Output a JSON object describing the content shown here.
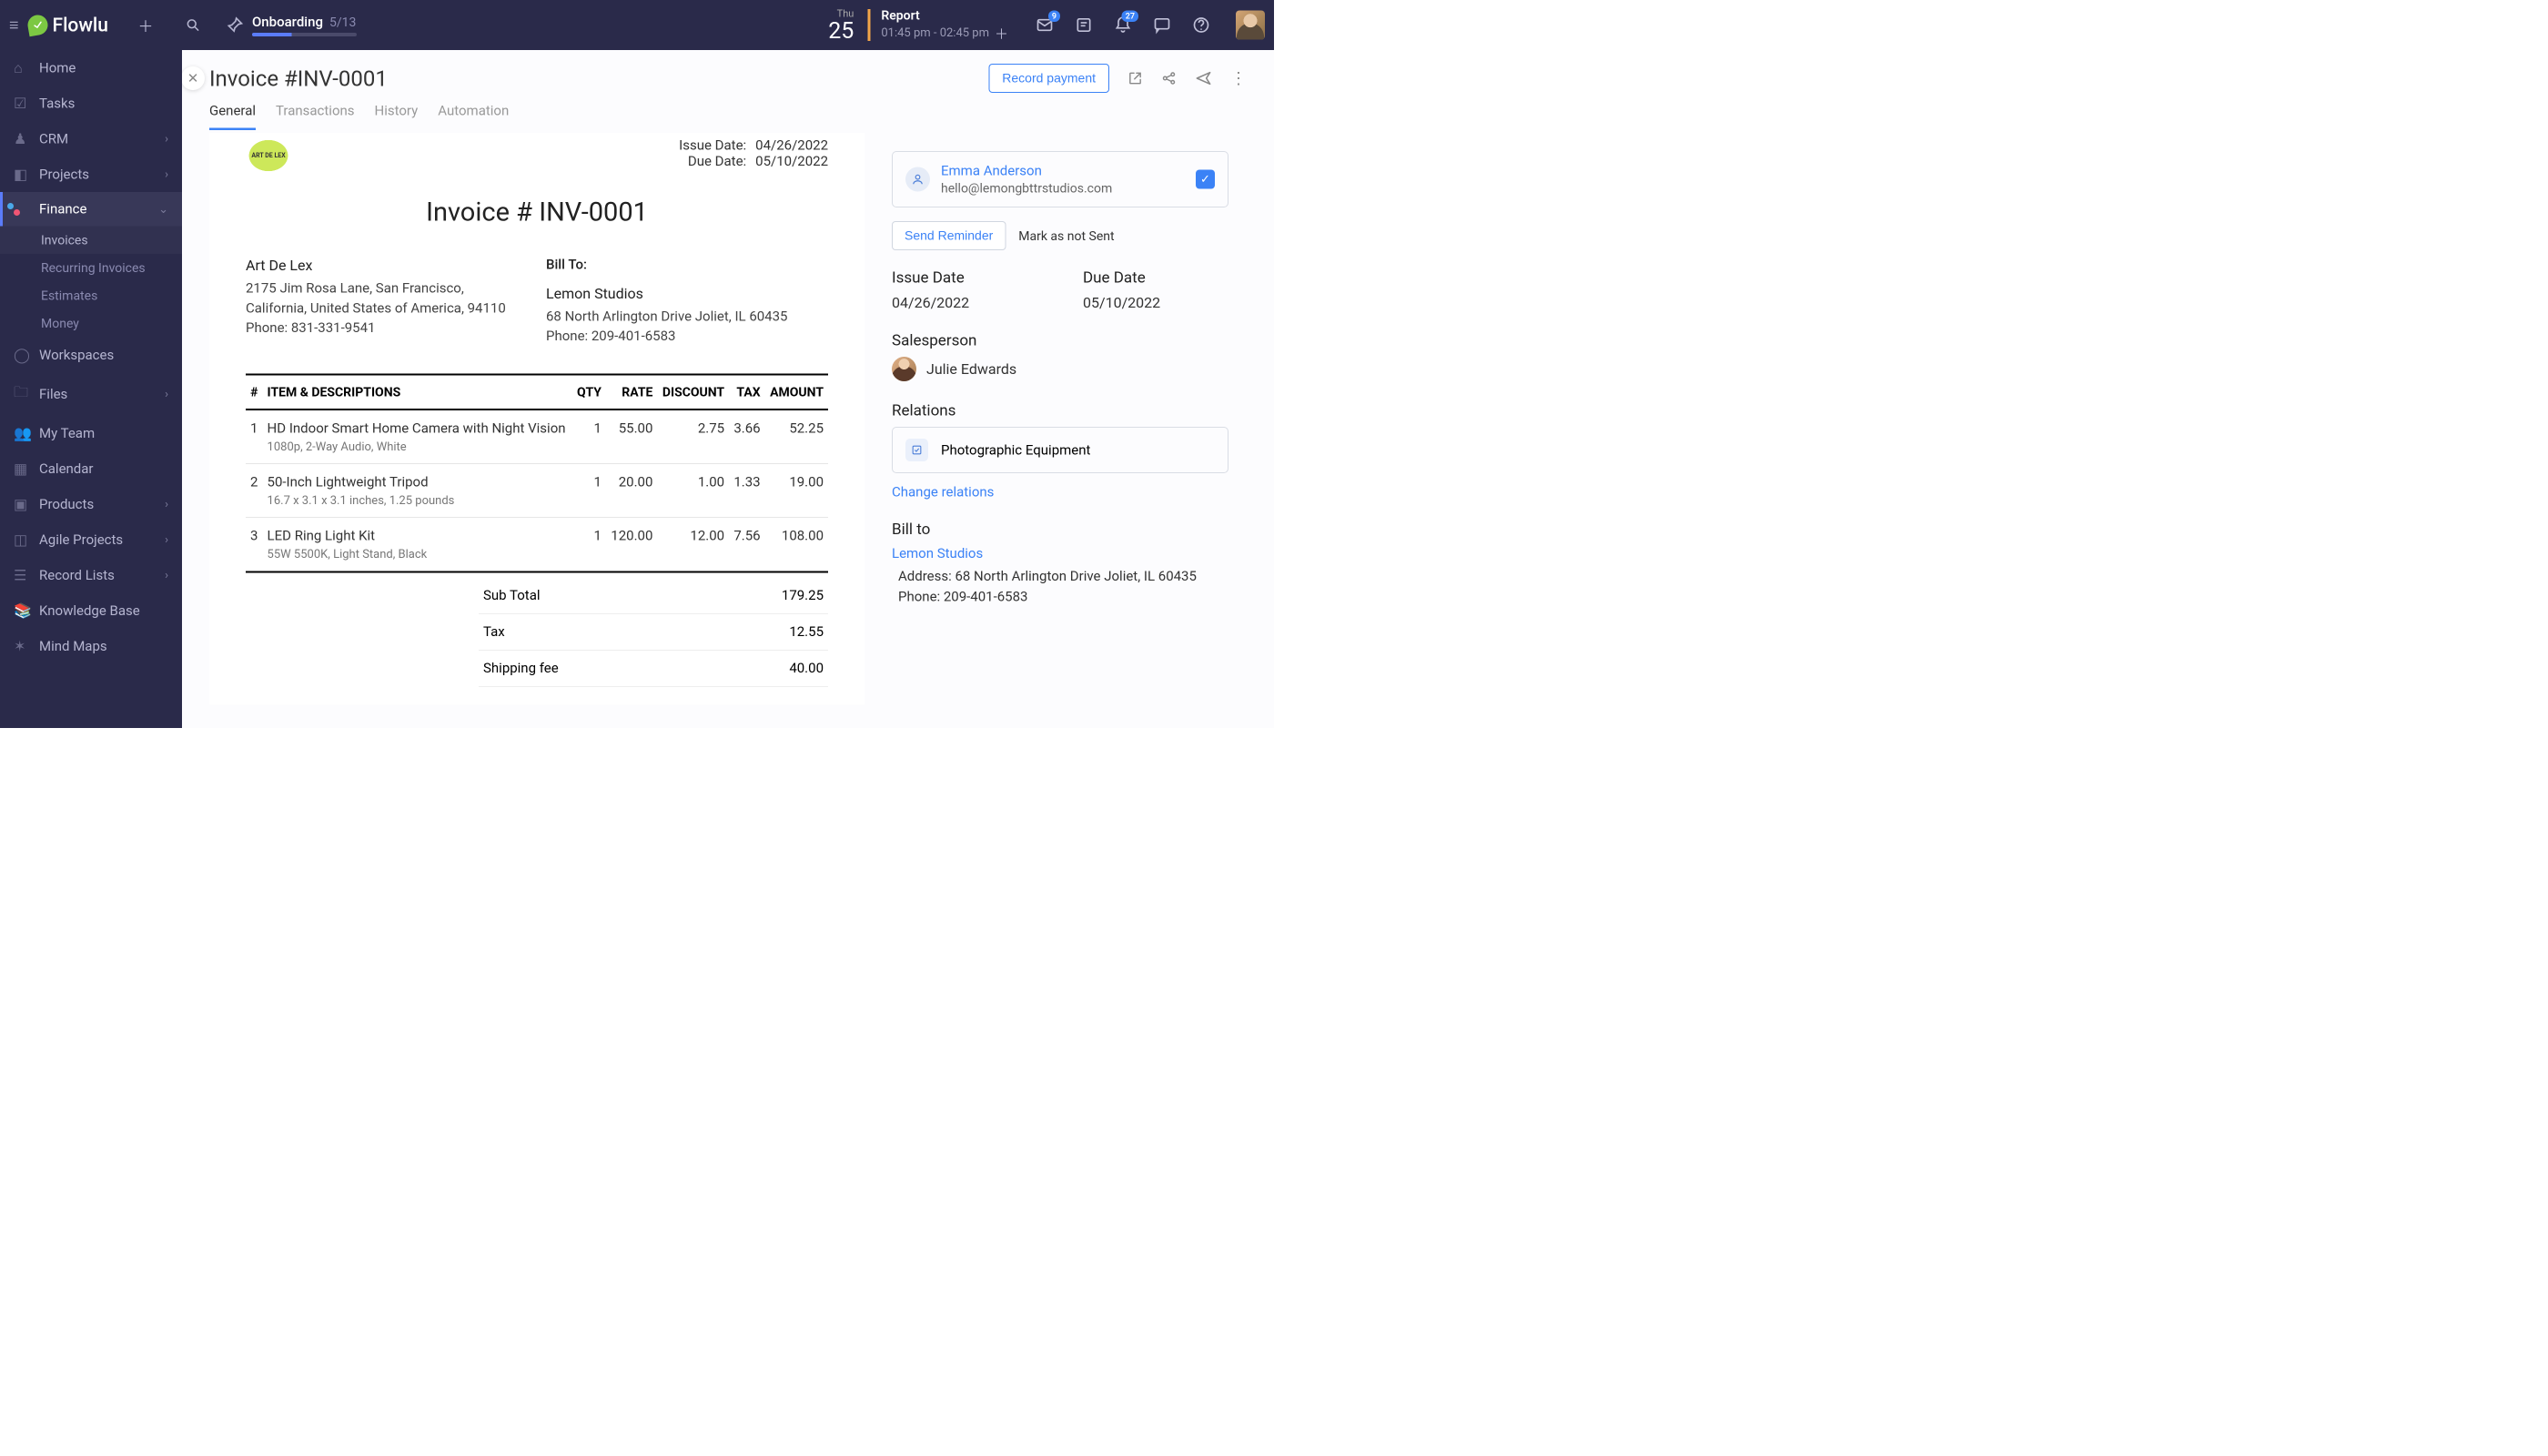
{
  "brand": "Flowlu",
  "topbar": {
    "onboarding_label": "Onboarding",
    "onboarding_count": "5/13",
    "day_name": "Thu",
    "day_num": "25",
    "report_label": "Report",
    "report_time": "01:45 pm - 02:45 pm",
    "mail_badge": "9",
    "bell_badge": "27"
  },
  "sidebar": {
    "home": "Home",
    "tasks": "Tasks",
    "crm": "CRM",
    "projects": "Projects",
    "finance": "Finance",
    "invoices": "Invoices",
    "recurring": "Recurring Invoices",
    "estimates": "Estimates",
    "money": "Money",
    "workspaces": "Workspaces",
    "files": "Files",
    "myteam": "My Team",
    "calendar": "Calendar",
    "products": "Products",
    "agile": "Agile Projects",
    "recordlists": "Record Lists",
    "knowledge": "Knowledge Base",
    "mindmaps": "Mind Maps"
  },
  "header": {
    "title": "Invoice #INV-0001",
    "record_payment": "Record payment"
  },
  "tabs": {
    "general": "General",
    "transactions": "Transactions",
    "history": "History",
    "automation": "Automation"
  },
  "doc": {
    "logo_text": "ART DE LEX",
    "issue_label": "Issue Date:",
    "issue_value": "04/26/2022",
    "due_label": "Due Date:",
    "due_value": "05/10/2022",
    "title": "Invoice # INV-0001",
    "from_name": "Art De Lex",
    "from_addr": "2175 Jim Rosa Lane, San Francisco, California, United States of America, 94110",
    "from_phone": "Phone: 831-331-9541",
    "billto_h": "Bill To:",
    "to_name": "Lemon Studios",
    "to_addr": "68 North Arlington Drive Joliet, IL 60435",
    "to_phone": "Phone: 209-401-6583",
    "cols": {
      "num": "#",
      "item": "ITEM & DESCRIPTIONS",
      "qty": "QTY",
      "rate": "RATE",
      "disc": "DISCOUNT",
      "tax": "TAX",
      "amt": "AMOUNT"
    },
    "items": [
      {
        "n": "1",
        "name": "HD Indoor Smart Home Camera with Night Vision",
        "sub": "1080p, 2-Way Audio, White",
        "qty": "1",
        "rate": "55.00",
        "disc": "2.75",
        "tax": "3.66",
        "amt": "52.25"
      },
      {
        "n": "2",
        "name": "50-Inch Lightweight Tripod",
        "sub": "16.7 x 3.1 x 3.1 inches, 1.25 pounds",
        "qty": "1",
        "rate": "20.00",
        "disc": "1.00",
        "tax": "1.33",
        "amt": "19.00"
      },
      {
        "n": "3",
        "name": "LED Ring Light Kit",
        "sub": "55W 5500K, Light Stand, Black",
        "qty": "1",
        "rate": "120.00",
        "disc": "12.00",
        "tax": "7.56",
        "amt": "108.00"
      }
    ],
    "totals": {
      "subtotal_l": "Sub Total",
      "subtotal_v": "179.25",
      "tax_l": "Tax",
      "tax_v": "12.55",
      "ship_l": "Shipping fee",
      "ship_v": "40.00"
    }
  },
  "side": {
    "contact_name": "Emma Anderson",
    "contact_email": "hello@lemongbttrstudios.com",
    "send_reminder": "Send Reminder",
    "mark_not_sent": "Mark as not Sent",
    "issue_label": "Issue Date",
    "issue_value": "04/26/2022",
    "due_label": "Due Date",
    "due_value": "05/10/2022",
    "salesperson_label": "Salesperson",
    "salesperson_name": "Julie Edwards",
    "relations_label": "Relations",
    "relation_name": "Photographic Equipment",
    "change_relations": "Change relations",
    "billto_label": "Bill to",
    "billto_cust": "Lemon Studios",
    "billto_addr": "Address: 68 North Arlington Drive Joliet, IL 60435",
    "billto_phone": "Phone: 209-401-6583"
  }
}
